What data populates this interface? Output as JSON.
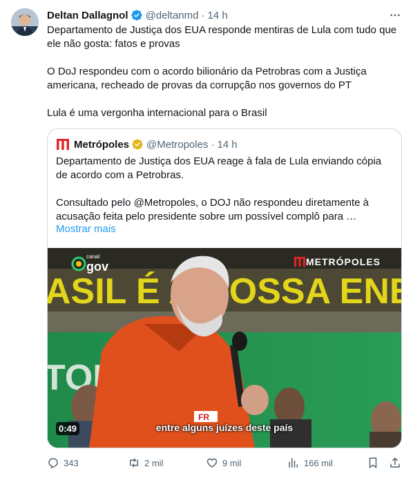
{
  "tweet": {
    "author_name": "Deltan Dallagnol",
    "handle": "@deltanmd",
    "separator": "·",
    "time": "14 h",
    "paragraphs": [
      "Departamento de Justiça dos EUA responde mentiras de Lula com tudo que ele não gosta: fatos e provas",
      "O DoJ respondeu com o acordo bilionário da Petrobras com a Justiça americana, recheado de provas da corrupção nos governos do PT",
      "Lula é uma vergonha internacional para o Brasil"
    ]
  },
  "quote": {
    "author_name": "Metrópoles",
    "handle": "@Metropoles",
    "separator": "·",
    "time": "14 h",
    "paragraphs": [
      "Departamento de Justiça dos EUA reage à fala de Lula enviando cópia de acordo com a Petrobras.",
      "Consultado pelo @Metropoles, o DOJ não respondeu diretamente à acusação feita pelo presidente sobre um possível complô para …"
    ],
    "show_more": "Mostrar mais",
    "media": {
      "duration": "0:49",
      "subtitle": "entre alguns juízes deste país",
      "banner_text": "ASIL É A NOSSA ENE",
      "brand_overlay": "METRÓPOLES",
      "channel_logo": "gov",
      "channel_logo_small": "canal",
      "badge_text": "FR",
      "background_text": "TON"
    }
  },
  "actions": {
    "replies": "343",
    "retweets": "2 mil",
    "likes": "9 mil",
    "views": "166 mil"
  },
  "colors": {
    "verified": "#1d9bf0",
    "muted": "#536471",
    "link": "#1d9bf0",
    "metropoles_red": "#e0262a"
  }
}
